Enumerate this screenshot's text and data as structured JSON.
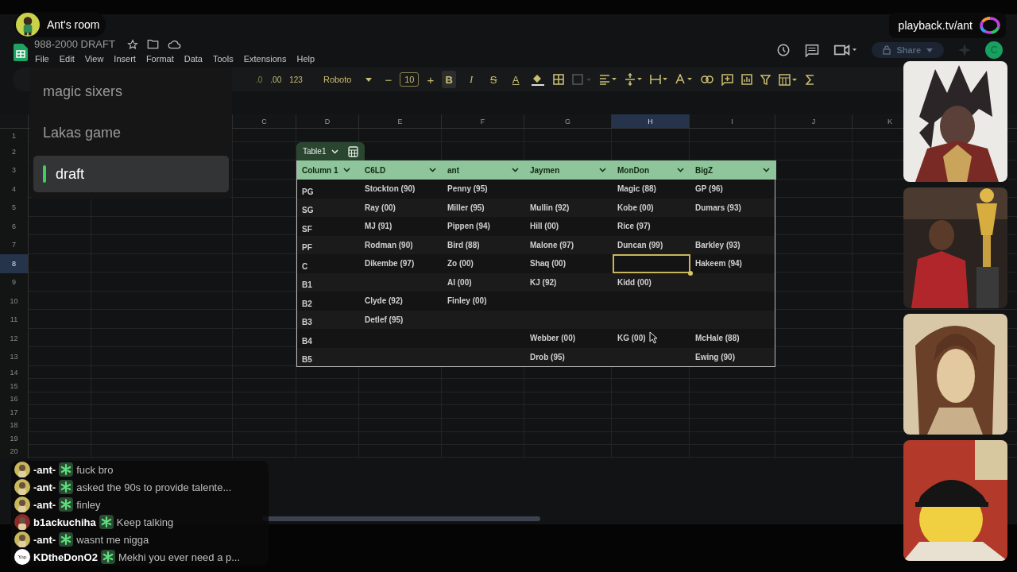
{
  "stream_overlay": {
    "room_name": "Ant's room",
    "channel_url": "playback.tv/ant",
    "scenes": [
      {
        "label": "magic sixers",
        "selected": false
      },
      {
        "label": "Lakas game",
        "selected": false
      },
      {
        "label": "draft",
        "selected": true
      }
    ],
    "chat": [
      {
        "name": "-ant-",
        "message": "fuck bro"
      },
      {
        "name": "-ant-",
        "message": "asked the 90s to provide talente..."
      },
      {
        "name": "-ant-",
        "message": "finley"
      },
      {
        "name": "b1ackuchiha",
        "message": "Keep talking"
      },
      {
        "name": "-ant-",
        "message": "wasnt me nigga"
      },
      {
        "name": "KDtheDonO2",
        "message": "Mekhi you ever need a p...",
        "avatar": {
          "kind": "text",
          "text": "Yap"
        }
      }
    ]
  },
  "document": {
    "title": "988-2000 DRAFT",
    "menus": [
      "File",
      "Edit",
      "View",
      "Insert",
      "Format",
      "Data",
      "Tools",
      "Extensions",
      "Help"
    ],
    "share_label": "Share",
    "account_initial": "C"
  },
  "toolbar": {
    "decrease_decimal": ".0",
    "increase_decimal": ".00",
    "number_format": "123",
    "font": "Roboto",
    "font_size_down": "−",
    "font_size": "10",
    "font_size_up": "+",
    "format_buttons": [
      {
        "label": "B",
        "kind": "bold",
        "selected": true
      },
      {
        "label": "I",
        "kind": "italic",
        "selected": false
      },
      {
        "label": "S",
        "kind": "strike",
        "selected": false
      },
      {
        "label": "A",
        "kind": "color",
        "selected": false
      }
    ]
  },
  "sheet": {
    "columns": [
      {
        "label": "C",
        "selected": false
      },
      {
        "label": "D",
        "selected": false
      },
      {
        "label": "E",
        "selected": false
      },
      {
        "label": "F",
        "selected": false
      },
      {
        "label": "G",
        "selected": false
      },
      {
        "label": "H",
        "selected": true
      },
      {
        "label": "I",
        "selected": false
      },
      {
        "label": "J",
        "selected": false
      },
      {
        "label": "K",
        "selected": false
      }
    ],
    "rows": [
      {
        "label": "1",
        "selected": false
      },
      {
        "label": "2",
        "selected": false
      },
      {
        "label": "3",
        "selected": false
      },
      {
        "label": "4",
        "selected": false
      },
      {
        "label": "5",
        "selected": false
      },
      {
        "label": "6",
        "selected": false
      },
      {
        "label": "7",
        "selected": false
      },
      {
        "label": "8",
        "selected": true
      },
      {
        "label": "9",
        "selected": false
      },
      {
        "label": "10",
        "selected": false
      },
      {
        "label": "11",
        "selected": false
      },
      {
        "label": "12",
        "selected": false
      },
      {
        "label": "13",
        "selected": false
      },
      {
        "label": "14",
        "selected": false
      },
      {
        "label": "15",
        "selected": false
      },
      {
        "label": "16",
        "selected": false
      },
      {
        "label": "17",
        "selected": false
      },
      {
        "label": "18",
        "selected": false
      },
      {
        "label": "19",
        "selected": false
      },
      {
        "label": "20",
        "selected": false
      }
    ]
  },
  "table": {
    "name": "Table1",
    "columns": [
      "Column 1",
      "C6LD",
      "ant",
      "Jaymen",
      "MonDon",
      "BigZ"
    ],
    "rows": [
      {
        "cells": [
          {
            "text": "PG",
            "selected": false
          },
          {
            "text": "Stockton (90)",
            "selected": false
          },
          {
            "text": "Penny (95)",
            "selected": false
          },
          {
            "selected": false
          },
          {
            "text": "Magic (88)",
            "selected": false
          },
          {
            "text": "GP (96)",
            "selected": false
          }
        ]
      },
      {
        "cells": [
          {
            "text": "SG",
            "selected": false
          },
          {
            "text": "Ray (00)",
            "selected": false
          },
          {
            "text": "Miller (95)",
            "selected": false
          },
          {
            "text": "Mullin (92)",
            "selected": false
          },
          {
            "text": "Kobe (00)",
            "selected": false
          },
          {
            "text": "Dumars (93)",
            "selected": false
          }
        ]
      },
      {
        "cells": [
          {
            "text": "SF",
            "selected": false
          },
          {
            "text": "MJ (91)",
            "selected": false
          },
          {
            "text": "Pippen (94)",
            "selected": false
          },
          {
            "text": "Hill (00)",
            "selected": false
          },
          {
            "text": "Rice (97)",
            "selected": false
          },
          {
            "selected": false
          }
        ]
      },
      {
        "cells": [
          {
            "text": "PF",
            "selected": false
          },
          {
            "text": "Rodman (90)",
            "selected": false
          },
          {
            "text": "Bird (88)",
            "selected": false
          },
          {
            "text": "Malone (97)",
            "selected": false
          },
          {
            "text": "Duncan (99)",
            "selected": false
          },
          {
            "text": "Barkley (93)",
            "selected": false
          }
        ]
      },
      {
        "cells": [
          {
            "text": "C",
            "selected": false
          },
          {
            "text": "Dikembe (97)",
            "selected": false
          },
          {
            "text": "Zo (00)",
            "selected": false
          },
          {
            "text": "Shaq (00)",
            "selected": false
          },
          {
            "selected": true
          },
          {
            "text": "Hakeem (94)",
            "selected": false
          }
        ]
      },
      {
        "cells": [
          {
            "text": "B1",
            "selected": false
          },
          {
            "selected": false
          },
          {
            "text": "AI (00)",
            "selected": false
          },
          {
            "text": "KJ (92)",
            "selected": false
          },
          {
            "text": "Kidd (00)",
            "selected": false
          },
          {
            "selected": false
          }
        ]
      },
      {
        "cells": [
          {
            "text": "B2",
            "selected": false
          },
          {
            "text": "Clyde (92)",
            "selected": false
          },
          {
            "text": "Finley (00)",
            "selected": false
          },
          {
            "selected": false
          },
          {
            "selected": false
          },
          {
            "selected": false
          }
        ]
      },
      {
        "cells": [
          {
            "text": "B3",
            "selected": false
          },
          {
            "text": "Detlef (95)",
            "selected": false
          },
          {
            "selected": false
          },
          {
            "selected": false
          },
          {
            "selected": false
          },
          {
            "selected": false
          }
        ]
      },
      {
        "cells": [
          {
            "text": "B4",
            "selected": false
          },
          {
            "selected": false
          },
          {
            "selected": false
          },
          {
            "text": "Webber (00)",
            "selected": false
          },
          {
            "text": "KG (00)",
            "selected": false
          },
          {
            "text": "McHale (88)",
            "selected": false
          }
        ]
      },
      {
        "cells": [
          {
            "text": "B5",
            "selected": false
          },
          {
            "selected": false
          },
          {
            "selected": false
          },
          {
            "text": "Drob (95)",
            "selected": false
          },
          {
            "selected": false
          },
          {
            "text": "Ewing (90)",
            "selected": false
          }
        ]
      }
    ]
  }
}
